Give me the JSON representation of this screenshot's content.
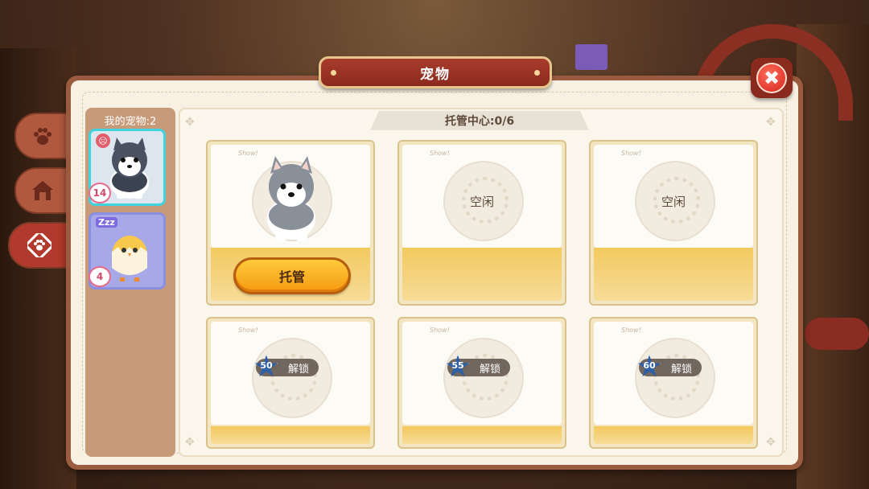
{
  "window": {
    "title": "宠物"
  },
  "close_button": {
    "icon": "close-icon",
    "glyph": "✖"
  },
  "tabs": [
    {
      "icon": "paw-icon",
      "active": false
    },
    {
      "icon": "house-icon",
      "active": false
    },
    {
      "icon": "paw-ticket-icon",
      "active": true
    }
  ],
  "pet_list": {
    "label": "我的宠物:2",
    "pets": [
      {
        "name": "husky",
        "level": "14",
        "status": "sad-icon",
        "selected": true
      },
      {
        "name": "chick",
        "level": "4",
        "status": "Zzz",
        "selected": false
      }
    ]
  },
  "daycare": {
    "header": "托管中心:0/6",
    "slots": [
      {
        "state": "pet",
        "button_label": "托管"
      },
      {
        "state": "idle",
        "label": "空闲"
      },
      {
        "state": "idle",
        "label": "空闲"
      },
      {
        "state": "locked",
        "level": "50",
        "label": "解锁"
      },
      {
        "state": "locked",
        "level": "55",
        "label": "解锁"
      },
      {
        "state": "locked",
        "level": "60",
        "label": "解锁"
      }
    ],
    "show_text": "Show!"
  },
  "colors": {
    "accent_red": "#8a2a1e",
    "panel_border": "#9a5b3e",
    "button_orange": "#f59a10",
    "selected_cyan": "#3ed3dd"
  }
}
